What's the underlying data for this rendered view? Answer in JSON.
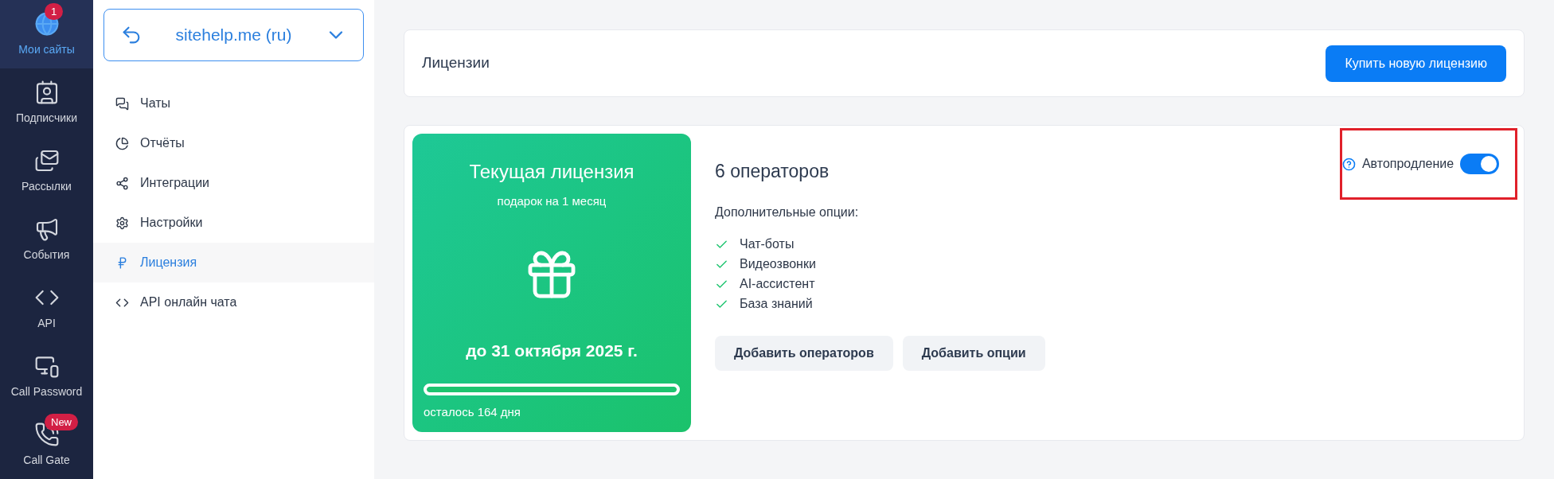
{
  "nav": [
    {
      "label": "Мои сайты",
      "selected": true,
      "badge": "1"
    },
    {
      "label": "Подписчики",
      "selected": false
    },
    {
      "label": "Рассылки",
      "selected": false
    },
    {
      "label": "События",
      "selected": false
    },
    {
      "label": "API",
      "selected": false
    },
    {
      "label": "Call Password",
      "selected": false
    },
    {
      "label": "Call Gate",
      "selected": false,
      "badge": "New"
    }
  ],
  "site_selector": {
    "value": "sitehelp.me (ru)"
  },
  "menu": [
    {
      "label": "Чаты",
      "selected": false
    },
    {
      "label": "Отчёты",
      "selected": false
    },
    {
      "label": "Интеграции",
      "selected": false
    },
    {
      "label": "Настройки",
      "selected": false
    },
    {
      "label": "Лицензия",
      "selected": true
    },
    {
      "label": "API онлайн чата",
      "selected": false
    }
  ],
  "header": {
    "title": "Лицензии",
    "button": "Купить новую лицензию"
  },
  "license": {
    "title": "Текущая лицензия",
    "subtitle": "подарок на 1 месяц",
    "until": "до 31 октября 2025 г.",
    "level": 1,
    "remaining": "осталось 164 дня",
    "operators": "6 операторов",
    "options_label": "Дополнительные опции:",
    "options": [
      {
        "label": "Чат-боты",
        "checked": true
      },
      {
        "label": "Видеозвонки",
        "checked": true
      },
      {
        "label": "AI-ассистент",
        "checked": true
      },
      {
        "label": "База знаний",
        "checked": true
      }
    ],
    "buttons": [
      "Добавить операторов",
      "Добавить опции"
    ],
    "autorenew": {
      "label": "Автопродление",
      "on": true,
      "highlighted": true
    }
  }
}
